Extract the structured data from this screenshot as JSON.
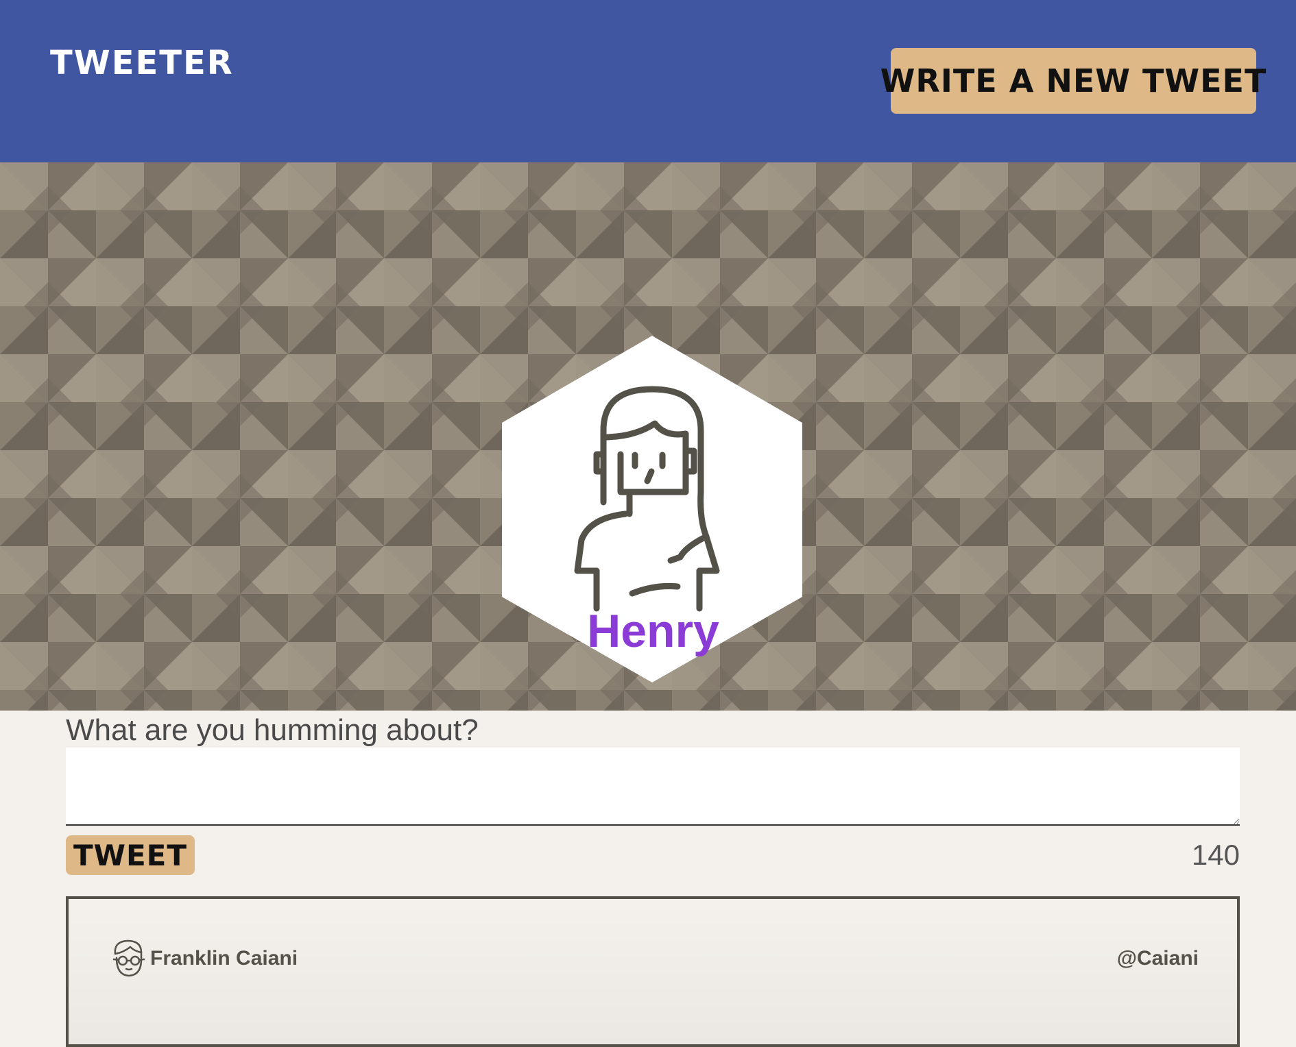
{
  "nav": {
    "brand": "TWEETER",
    "write_button_label": "WRITE A NEW TWEET",
    "background_color": "#4056a1",
    "button_color": "#deb887"
  },
  "profile": {
    "avatar_icon": "woman-avatar-icon",
    "name": "Henry",
    "name_color": "#8b3bd6",
    "background": "geometric-pattern"
  },
  "compose": {
    "label": "What are you humming about?",
    "input_value": "",
    "tweet_button_label": "TWEET",
    "char_counter": "140"
  },
  "tweets": [
    {
      "avatar_icon": "man-with-glasses-avatar-icon",
      "author_name": "Franklin Caiani",
      "handle": "@Caiani"
    }
  ]
}
